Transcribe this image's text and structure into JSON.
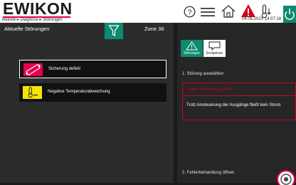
{
  "header": {
    "logo": "EWIKON",
    "breadcrumb": "Betrieb ▸ Diagnose ▸ Störungen",
    "datetime": "04.05.2020 14:07:18",
    "colors": {
      "brand_red": "#e5004b",
      "accent_green": "#0d8a6f",
      "alarm_red": "#d0021b"
    },
    "icons": [
      "help-icon",
      "menu-icon",
      "home-icon",
      "alarm-warning-icon",
      "temperature-icon",
      "power-icon"
    ]
  },
  "faults_panel": {
    "title": "Aktuelle Störungen",
    "zone": "Zone 36",
    "items": [
      {
        "label": "Sicherung defekt",
        "icon": "fuse-icon",
        "selected": true
      },
      {
        "label": "Negative Temperaturabweichung",
        "icon": "thermometer-minus-icon",
        "selected": false
      }
    ]
  },
  "detail_panel": {
    "tabs": [
      {
        "label": "Störungen",
        "icon": "warning-outline-icon"
      },
      {
        "label": "Ereignisse",
        "icon": "speech-bubble-icon"
      }
    ],
    "step1": "1. Störung auswählen",
    "alarm_title": "Alarm: Sicherung defekt",
    "alarm_text": "Trotz Ansteuerung der Ausgänge fließt kein Strom",
    "step2": "2. Fehlerbehandlung öffnen"
  }
}
